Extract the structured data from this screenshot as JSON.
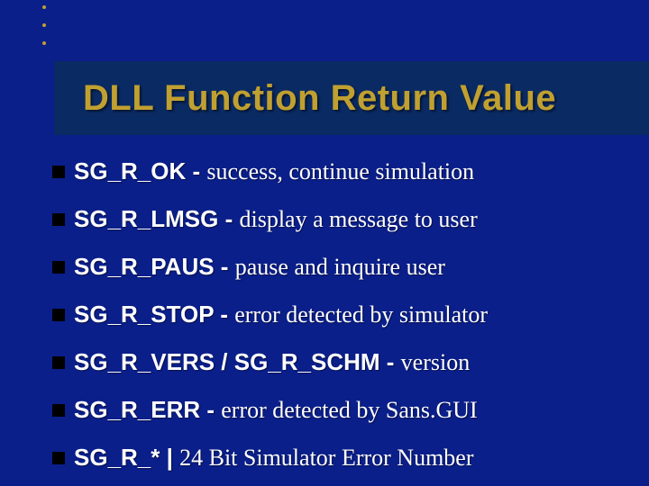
{
  "title": "DLL Function Return Value",
  "items": [
    {
      "code": "SG_R_OK - ",
      "desc": "success, continue simulation"
    },
    {
      "code": "SG_R_LMSG - ",
      "desc": "display a message to user"
    },
    {
      "code": "SG_R_PAUS - ",
      "desc": "pause and inquire user"
    },
    {
      "code": "SG_R_STOP - ",
      "desc": "error detected by simulator"
    },
    {
      "code": "SG_R_VERS / SG_R_SCHM - ",
      "desc": "version"
    },
    {
      "code": "SG_R_ERR - ",
      "desc": "error detected by Sans.GUI"
    },
    {
      "code": "SG_R_* | ",
      "desc": "24 Bit Simulator Error Number"
    }
  ]
}
